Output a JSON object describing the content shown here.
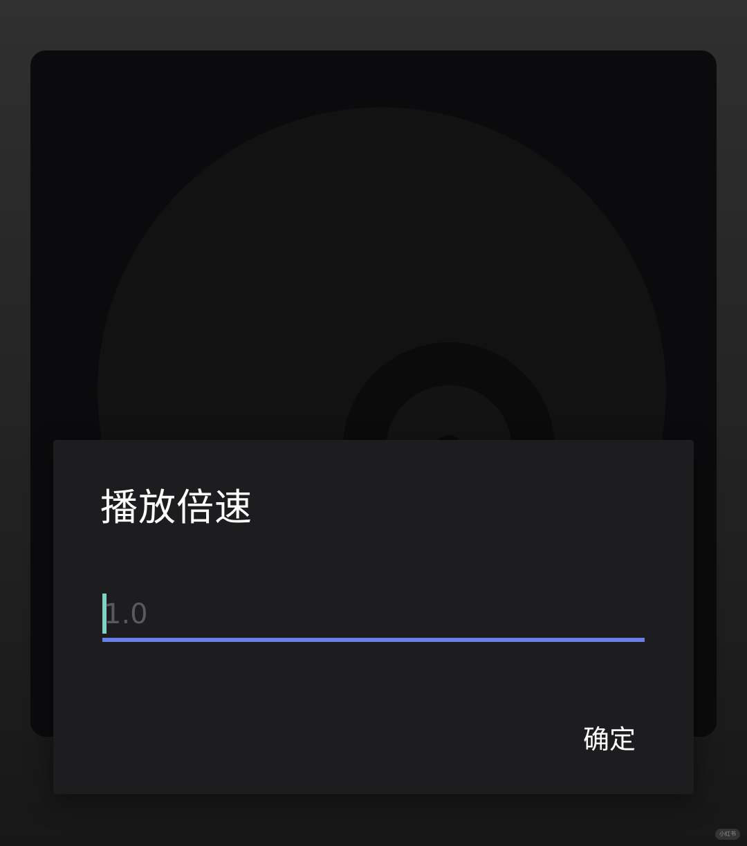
{
  "dialog": {
    "title": "播放倍速",
    "input": {
      "value": "",
      "placeholder": "1.0"
    },
    "confirm_label": "确定"
  },
  "album": {
    "art": "vinyl-disc-placeholder-icon"
  },
  "watermark": {
    "text": "小红书"
  },
  "colors": {
    "dialog_background": "#1d1c1f",
    "card_background": "#0b0a0c",
    "underline_accent": "#6b80e6",
    "cursor_accent": "#7fd3c4"
  }
}
